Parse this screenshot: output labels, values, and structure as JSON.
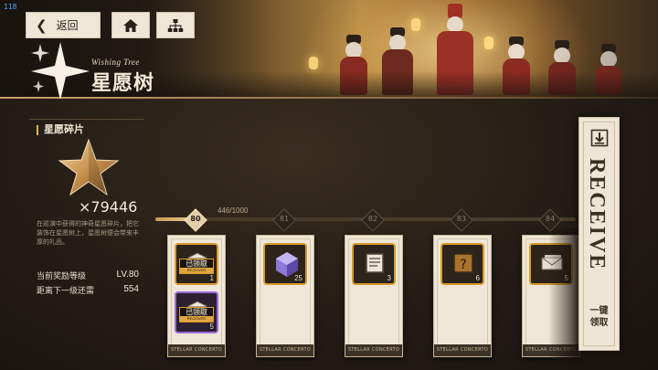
{
  "debug": {
    "fps": "118"
  },
  "nav": {
    "back_label": "返回"
  },
  "title": {
    "en": "Wishing Tree",
    "cn": "星愿树"
  },
  "shards": {
    "section_title": "星愿碎片",
    "count": "×79446",
    "description": "在巡演中获得的神奇星愿碎片，把它装饰在星愿树上，星愿树便会带来丰厚的礼品。"
  },
  "stats": {
    "current_level_label": "当前奖励等级",
    "current_level_value": "LV.80",
    "next_label": "距离下一级还需",
    "next_value": "554"
  },
  "progress": {
    "text": "446/1000",
    "fraction": 0.446
  },
  "levels": [
    {
      "num": "80",
      "current": true
    },
    {
      "num": "81",
      "current": false
    },
    {
      "num": "82",
      "current": false
    },
    {
      "num": "83",
      "current": false
    },
    {
      "num": "84",
      "current": false
    }
  ],
  "cards": [
    {
      "level": "80",
      "footer": "STELLAR CONCERTO",
      "items": [
        {
          "icon": "box-icon",
          "qty": "1",
          "claimed": true,
          "rarity": "gold"
        },
        {
          "icon": "box-icon",
          "qty": "5",
          "claimed": true,
          "rarity": "purple"
        }
      ]
    },
    {
      "level": "81",
      "footer": "STELLAR CONCERTO",
      "items": [
        {
          "icon": "crystal-cube-icon",
          "qty": "25",
          "claimed": false,
          "rarity": "gold"
        }
      ]
    },
    {
      "level": "82",
      "footer": "STELLAR CONCERTO",
      "items": [
        {
          "icon": "notebook-icon",
          "qty": "3",
          "claimed": false,
          "rarity": "gold"
        }
      ]
    },
    {
      "level": "83",
      "footer": "STELLAR CONCERTO",
      "items": [
        {
          "icon": "mystery-book-icon",
          "qty": "6",
          "claimed": false,
          "rarity": "gold"
        }
      ]
    },
    {
      "level": "84",
      "footer": "STELLAR CONCERTO",
      "items": [
        {
          "icon": "letters-icon",
          "qty": "5",
          "claimed": false,
          "rarity": "gold"
        }
      ]
    }
  ],
  "claimed_label": {
    "cn": "已领取",
    "en": "RECEIVED"
  },
  "receive": {
    "word": "RECEIVE",
    "cn_line1": "一键",
    "cn_line2": "领取"
  },
  "colors": {
    "accent_gold": "#d89a2c",
    "rare_purple": "#9b6ad6",
    "panel_bg": "#1c1611",
    "card_bg": "#efe6d7"
  }
}
